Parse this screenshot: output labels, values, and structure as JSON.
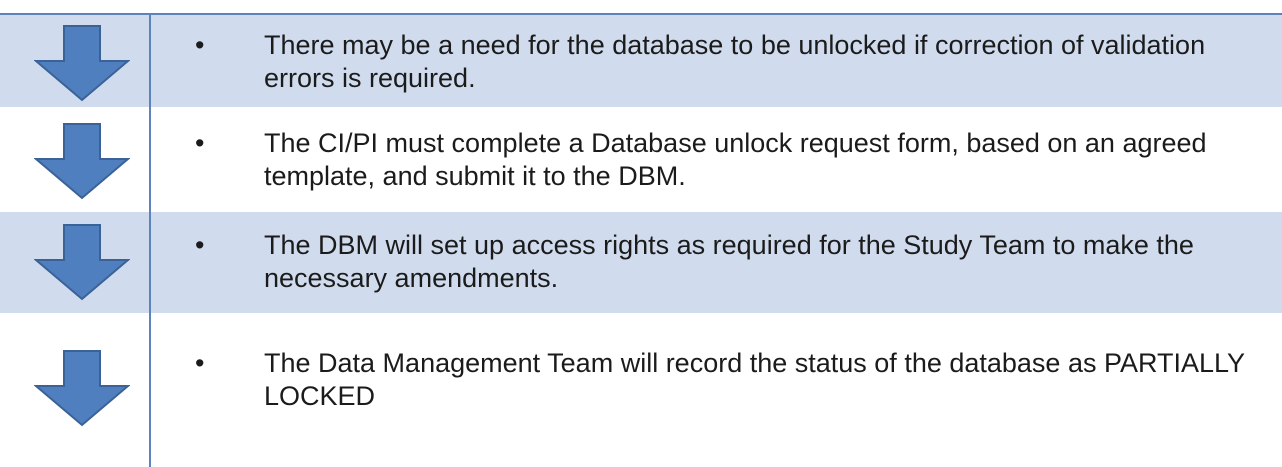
{
  "colors": {
    "accent": "#5B84BD",
    "row_shade": "#D0DCEE",
    "arrow_fill": "#4F7FBE",
    "arrow_stroke": "#3A6296"
  },
  "steps": [
    {
      "icon": "arrow-down-icon",
      "bullet": "•",
      "text": "There may be a need for the database to be unlocked if correction of validation errors is required."
    },
    {
      "icon": "arrow-down-icon",
      "bullet": "•",
      "text": "The CI/PI must complete a Database unlock request form, based on an agreed template, and submit it to the DBM."
    },
    {
      "icon": "arrow-down-icon",
      "bullet": "•",
      "text": "The DBM will set up access rights as required for the Study Team to make the necessary amendments."
    },
    {
      "icon": "arrow-down-icon",
      "bullet": "•",
      "text": "The Data Management Team will record the status of the database as PARTIALLY LOCKED"
    }
  ]
}
